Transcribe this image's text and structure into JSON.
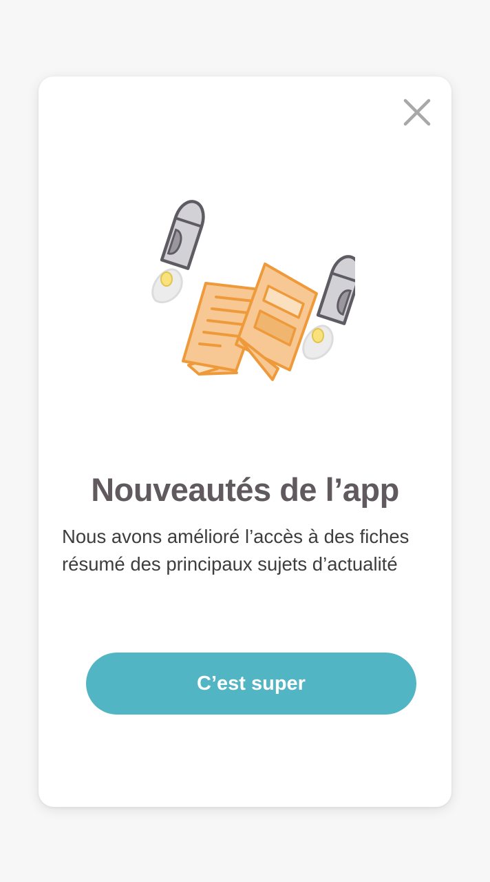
{
  "dialog": {
    "close_icon": "close-icon",
    "illustration_icon": "flying-newspaper-rockets-illustration",
    "title": "Nouveautés de l’app",
    "description_lines": [
      "Nous avons amélioré l’accès à des fiches",
      "résumé des principaux sujets d’actualité"
    ],
    "button_label": "C’est super"
  },
  "colors": {
    "background": "#f7f7f7",
    "card": "#ffffff",
    "title": "#605a5f",
    "text": "#3d3d3d",
    "button": "#52b5c4",
    "button_text": "#ffffff",
    "close": "#a8a8a8",
    "paper_fill": "#f7c894",
    "paper_stroke": "#ee9a3a",
    "rocket_body": "#d2d1d6",
    "rocket_stroke": "#5f5b63",
    "flame": "#f9e27b"
  }
}
